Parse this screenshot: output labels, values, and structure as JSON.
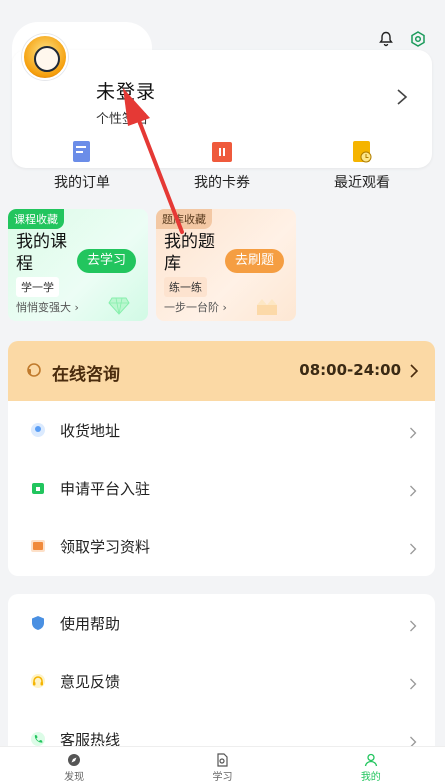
{
  "profile": {
    "name": "未登录",
    "signature": "个性签名"
  },
  "quick_links": [
    {
      "label": "我的订单",
      "icon": "order-icon",
      "color": "#6b8de8"
    },
    {
      "label": "我的卡券",
      "icon": "coupon-icon",
      "color": "#ef5a3c"
    },
    {
      "label": "最近观看",
      "icon": "history-icon",
      "color": "#f5b400"
    }
  ],
  "course_cards": [
    {
      "tag": "课程收藏",
      "title": "我的课程",
      "button": "去学习",
      "chip": "学一学",
      "footer": "悄悄变强大"
    },
    {
      "tag": "题库收藏",
      "title": "我的题库",
      "button": "去刷题",
      "chip": "练一练",
      "footer": "一步一台阶"
    }
  ],
  "consult": {
    "title": "在线咨询",
    "hours": "08:00-24:00"
  },
  "menu_group_1": [
    {
      "label": "收货地址",
      "icon": "location-icon",
      "color": "#5a9ef5"
    },
    {
      "label": "申请平台入驻",
      "icon": "store-icon",
      "color": "#22c55e"
    },
    {
      "label": "领取学习资料",
      "icon": "book-icon",
      "color": "#f08a3c"
    }
  ],
  "menu_group_2": [
    {
      "label": "使用帮助",
      "icon": "shield-icon",
      "color": "#4a90e2"
    },
    {
      "label": "意见反馈",
      "icon": "headset-icon",
      "color": "#f5b400"
    },
    {
      "label": "客服热线",
      "icon": "phone-icon",
      "color": "#22c55e"
    }
  ],
  "bottom_nav": [
    {
      "label": "发现",
      "icon": "compass-icon",
      "active": false
    },
    {
      "label": "学习",
      "icon": "study-icon",
      "active": false
    },
    {
      "label": "我的",
      "icon": "user-icon",
      "active": true
    }
  ],
  "colors": {
    "accent": "#22c55e",
    "consult_bg": "#fbd9a5",
    "annotation": "#e53935"
  }
}
